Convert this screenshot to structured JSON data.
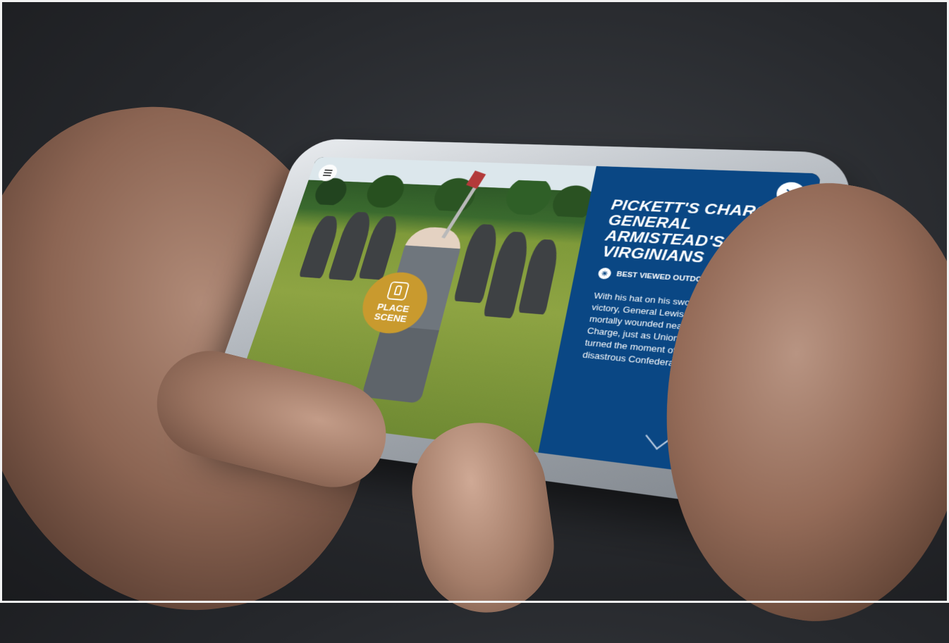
{
  "app": {
    "menu_icon": "hamburger-menu-icon",
    "place_scene": {
      "line1": "PLACE",
      "line2": "SCENE",
      "icon": "hand-tap-icon"
    },
    "panel": {
      "title": "PICKETT'S CHARGE: GENERAL ARMISTEAD'S VIRGINIANS",
      "close_icon": "close-icon",
      "tag": {
        "icon": "sun-icon",
        "label": "BEST VIEWED OUTDOORS"
      },
      "description": "With his hat on his sword and flushed with victory, General Lewis Armistead was mortally wounded nearby during Pickett's Charge, just as Union reinforcements turned the moment of great promise into a disastrous Confederate defeat.",
      "scroll_icon": "chevron-down-icon"
    },
    "colors": {
      "panel": "#0a4784",
      "accent": "#c99a2e"
    }
  }
}
